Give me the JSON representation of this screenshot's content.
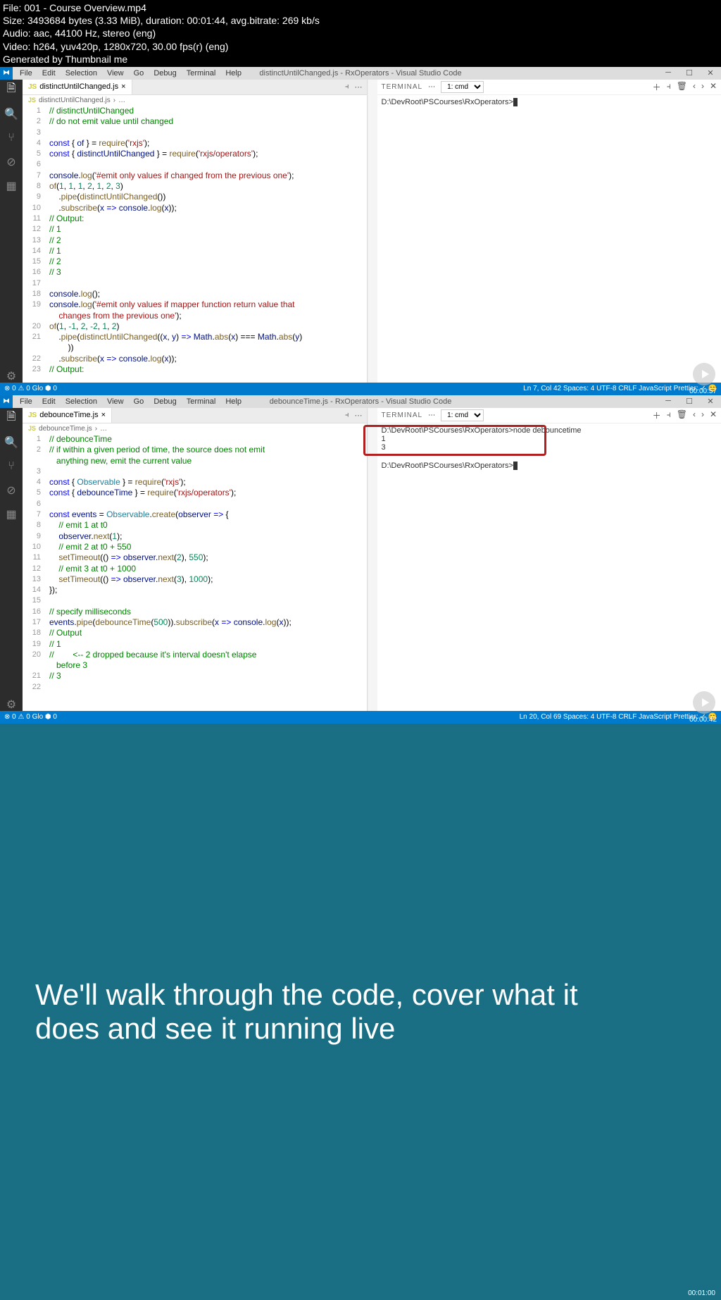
{
  "meta": {
    "file": "File: 001 - Course Overview.mp4",
    "size": "Size: 3493684 bytes (3.33 MiB), duration: 00:01:44, avg.bitrate: 269 kb/s",
    "audio": "Audio: aac, 44100 Hz, stereo (eng)",
    "video": "Video: h264, yuv420p, 1280x720, 30.00 fps(r) (eng)",
    "gen": "Generated by Thumbnail me"
  },
  "menu": [
    "File",
    "Edit",
    "Selection",
    "View",
    "Go",
    "Debug",
    "Terminal",
    "Help"
  ],
  "win1": {
    "title": "distinctUntilChanged.js - RxOperators - Visual Studio Code",
    "tab": "distinctUntilChanged.js",
    "breadcrumb": "distinctUntilChanged.js",
    "terminal_line": "D:\\DevRoot\\PSCourses\\RxOperators>",
    "status_left": "⊗ 0 ⚠ 0   Glo   ⬢ 0",
    "status_right": "Ln 7, Col 42   Spaces: 4   UTF-8   CRLF   JavaScript   Prettier: ✓   😊",
    "timestamp": "00:00:57",
    "code": [
      {
        "n": 1,
        "h": "<span class='c-comment'>// distinctUntilChanged</span>"
      },
      {
        "n": 2,
        "h": "<span class='c-comment'>// do not emit value until changed</span>"
      },
      {
        "n": 3,
        "h": ""
      },
      {
        "n": 4,
        "h": "<span class='c-keyword'>const</span> { <span class='c-var'>of</span> } = <span class='c-func'>require</span>(<span class='c-string'>'rxjs'</span>);"
      },
      {
        "n": 5,
        "h": "<span class='c-keyword'>const</span> { <span class='c-var'>distinctUntilChanged</span> } = <span class='c-func'>require</span>(<span class='c-string'>'rxjs/operators'</span>);"
      },
      {
        "n": 6,
        "h": ""
      },
      {
        "n": 7,
        "h": "<span class='c-var'>console</span>.<span class='c-func'>log</span>(<span class='c-string'>'#emit only values if changed from the previous one'</span>);"
      },
      {
        "n": 8,
        "h": "<span class='c-func'>of</span>(<span class='c-num'>1</span>, <span class='c-num'>1</span>, <span class='c-num'>1</span>, <span class='c-num'>2</span>, <span class='c-num'>1</span>, <span class='c-num'>2</span>, <span class='c-num'>3</span>)"
      },
      {
        "n": 9,
        "h": "    .<span class='c-func'>pipe</span>(<span class='c-func'>distinctUntilChanged</span>())"
      },
      {
        "n": 10,
        "h": "    .<span class='c-func'>subscribe</span>(<span class='c-var'>x</span> <span class='c-keyword'>=></span> <span class='c-var'>console</span>.<span class='c-func'>log</span>(<span class='c-var'>x</span>));"
      },
      {
        "n": 11,
        "h": "<span class='c-comment'>// Output:</span>"
      },
      {
        "n": 12,
        "h": "<span class='c-comment'>// 1</span>"
      },
      {
        "n": 13,
        "h": "<span class='c-comment'>// 2</span>"
      },
      {
        "n": 14,
        "h": "<span class='c-comment'>// 1</span>"
      },
      {
        "n": 15,
        "h": "<span class='c-comment'>// 2</span>"
      },
      {
        "n": 16,
        "h": "<span class='c-comment'>// 3</span>"
      },
      {
        "n": 17,
        "h": ""
      },
      {
        "n": 18,
        "h": "<span class='c-var'>console</span>.<span class='c-func'>log</span>();"
      },
      {
        "n": 19,
        "h": "<span class='c-var'>console</span>.<span class='c-func'>log</span>(<span class='c-string'>'#emit only values if mapper function return value that</span>"
      },
      {
        "n": "",
        "h": "<span class='c-string'>    changes from the previous one'</span>);"
      },
      {
        "n": 20,
        "h": "<span class='c-func'>of</span>(<span class='c-num'>1</span>, <span class='c-num'>-1</span>, <span class='c-num'>2</span>, <span class='c-num'>-2</span>, <span class='c-num'>1</span>, <span class='c-num'>2</span>)"
      },
      {
        "n": 21,
        "h": "    .<span class='c-func'>pipe</span>(<span class='c-func'>distinctUntilChanged</span>((<span class='c-var'>x</span>, <span class='c-var'>y</span>) <span class='c-keyword'>=></span> <span class='c-var'>Math</span>.<span class='c-func'>abs</span>(<span class='c-var'>x</span>) === <span class='c-var'>Math</span>.<span class='c-func'>abs</span>(<span class='c-var'>y</span>)"
      },
      {
        "n": "",
        "h": "        ))"
      },
      {
        "n": 22,
        "h": "    .<span class='c-func'>subscribe</span>(<span class='c-var'>x</span> <span class='c-keyword'>=></span> <span class='c-var'>console</span>.<span class='c-func'>log</span>(<span class='c-var'>x</span>));"
      },
      {
        "n": 23,
        "h": "<span class='c-comment'>// Output:</span>"
      }
    ]
  },
  "win2": {
    "title": "debounceTime.js - RxOperators - Visual Studio Code",
    "tab": "debounceTime.js",
    "breadcrumb": "debounceTime.js",
    "term_l1": "D:\\DevRoot\\PSCourses\\RxOperators>node debouncetime",
    "term_l2": "1",
    "term_l3": "3",
    "term_l4": "D:\\DevRoot\\PSCourses\\RxOperators>",
    "status_left": "⊗ 0 ⚠ 0   Glo   ⬢ 0",
    "status_right": "Ln 20, Col 69   Spaces: 4   UTF-8   CRLF   JavaScript   Prettier: ✓   😊",
    "timestamp": "00:00:42",
    "code": [
      {
        "n": 1,
        "h": "<span class='c-comment'>// debounceTime</span>"
      },
      {
        "n": 2,
        "h": "<span class='c-comment'>// if within a given period of time, the source does not emit</span>"
      },
      {
        "n": "",
        "h": "<span class='c-comment'>   anything new, emit the current value</span>"
      },
      {
        "n": 3,
        "h": ""
      },
      {
        "n": 4,
        "h": "<span class='c-keyword'>const</span> { <span class='c-type'>Observable</span> } = <span class='c-func'>require</span>(<span class='c-string'>'rxjs'</span>);"
      },
      {
        "n": 5,
        "h": "<span class='c-keyword'>const</span> { <span class='c-var'>debounceTime</span> } = <span class='c-func'>require</span>(<span class='c-string'>'rxjs/operators'</span>);"
      },
      {
        "n": 6,
        "h": ""
      },
      {
        "n": 7,
        "h": "<span class='c-keyword'>const</span> <span class='c-var'>events</span> = <span class='c-type'>Observable</span>.<span class='c-func'>create</span>(<span class='c-var'>observer</span> <span class='c-keyword'>=></span> {"
      },
      {
        "n": 8,
        "h": "    <span class='c-comment'>// emit 1 at t0</span>"
      },
      {
        "n": 9,
        "h": "    <span class='c-var'>observer</span>.<span class='c-func'>next</span>(<span class='c-num'>1</span>);"
      },
      {
        "n": 10,
        "h": "    <span class='c-comment'>// emit 2 at t0 + 550</span>"
      },
      {
        "n": 11,
        "h": "    <span class='c-func'>setTimeout</span>(() <span class='c-keyword'>=></span> <span class='c-var'>observer</span>.<span class='c-func'>next</span>(<span class='c-num'>2</span>), <span class='c-num'>550</span>);"
      },
      {
        "n": 12,
        "h": "    <span class='c-comment'>// emit 3 at t0 + 1000</span>"
      },
      {
        "n": 13,
        "h": "    <span class='c-func'>setTimeout</span>(() <span class='c-keyword'>=></span> <span class='c-var'>observer</span>.<span class='c-func'>next</span>(<span class='c-num'>3</span>), <span class='c-num'>1000</span>);"
      },
      {
        "n": 14,
        "h": "});"
      },
      {
        "n": 15,
        "h": ""
      },
      {
        "n": 16,
        "h": "<span class='c-comment'>// specify milliseconds</span>"
      },
      {
        "n": 17,
        "h": "<span class='c-var'>events</span>.<span class='c-func'>pipe</span>(<span class='c-func'>debounceTime</span>(<span class='c-num'>500</span>)).<span class='c-func'>subscribe</span>(<span class='c-var'>x</span> <span class='c-keyword'>=></span> <span class='c-var'>console</span>.<span class='c-func'>log</span>(<span class='c-var'>x</span>));"
      },
      {
        "n": 18,
        "h": "<span class='c-comment'>// Output</span>"
      },
      {
        "n": 19,
        "h": "<span class='c-comment'>// 1</span>"
      },
      {
        "n": 20,
        "h": "<span class='c-comment'>//        &lt;-- 2 dropped because it's interval doesn't elapse</span>"
      },
      {
        "n": "",
        "h": "<span class='c-comment'>   before 3</span>"
      },
      {
        "n": 21,
        "h": "<span class='c-comment'>// 3</span>"
      },
      {
        "n": 22,
        "h": ""
      }
    ]
  },
  "terminal_label": "TERMINAL",
  "terminal_select": "1: cmd",
  "promo": {
    "text": "We'll walk through the code, cover what it does and see it running live",
    "timestamp": "00:01:00"
  }
}
